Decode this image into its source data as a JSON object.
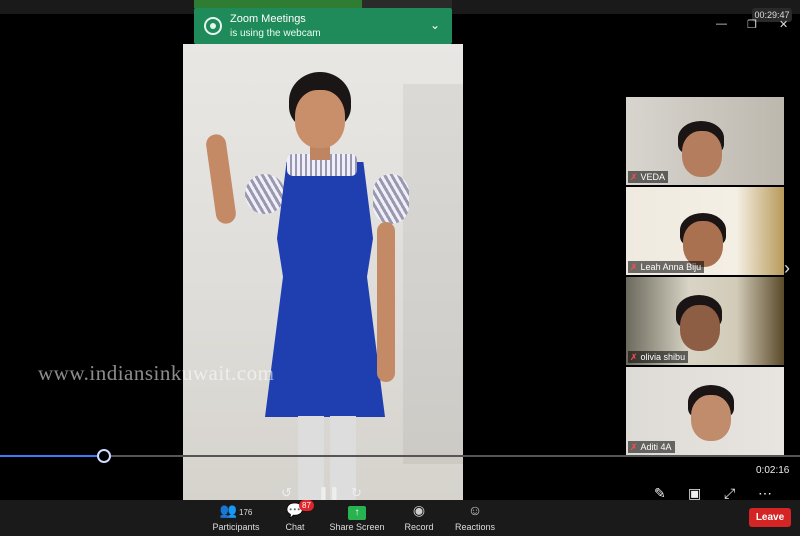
{
  "notification": {
    "title": "Zoom Meetings",
    "message": "is using the webcam",
    "icon": "webcam-icon"
  },
  "meeting_timer": "00:29:47",
  "watermark": "www.indiansinkuwait.com",
  "video": {
    "current_time": "0:02:16",
    "progress_fraction": 0.13
  },
  "participants_tiles": [
    {
      "name": "VEDA",
      "muted": true
    },
    {
      "name": "Leah Anna Biju",
      "muted": true
    },
    {
      "name": "olivia shibu",
      "muted": true
    },
    {
      "name": "Aditi 4A",
      "muted": true
    }
  ],
  "toolbar": {
    "participants_label": "Participants",
    "participants_count": "176",
    "chat_label": "Chat",
    "chat_badge": "87",
    "share_label": "Share Screen",
    "record_label": "Record",
    "reactions_label": "Reactions",
    "leave_label": "Leave"
  },
  "colors": {
    "notification_bg": "#1f8a5a",
    "share_green": "#27b34f",
    "leave_red": "#d42424",
    "seek_blue": "#3b7cff",
    "uniform_blue": "#1f3fb0"
  }
}
